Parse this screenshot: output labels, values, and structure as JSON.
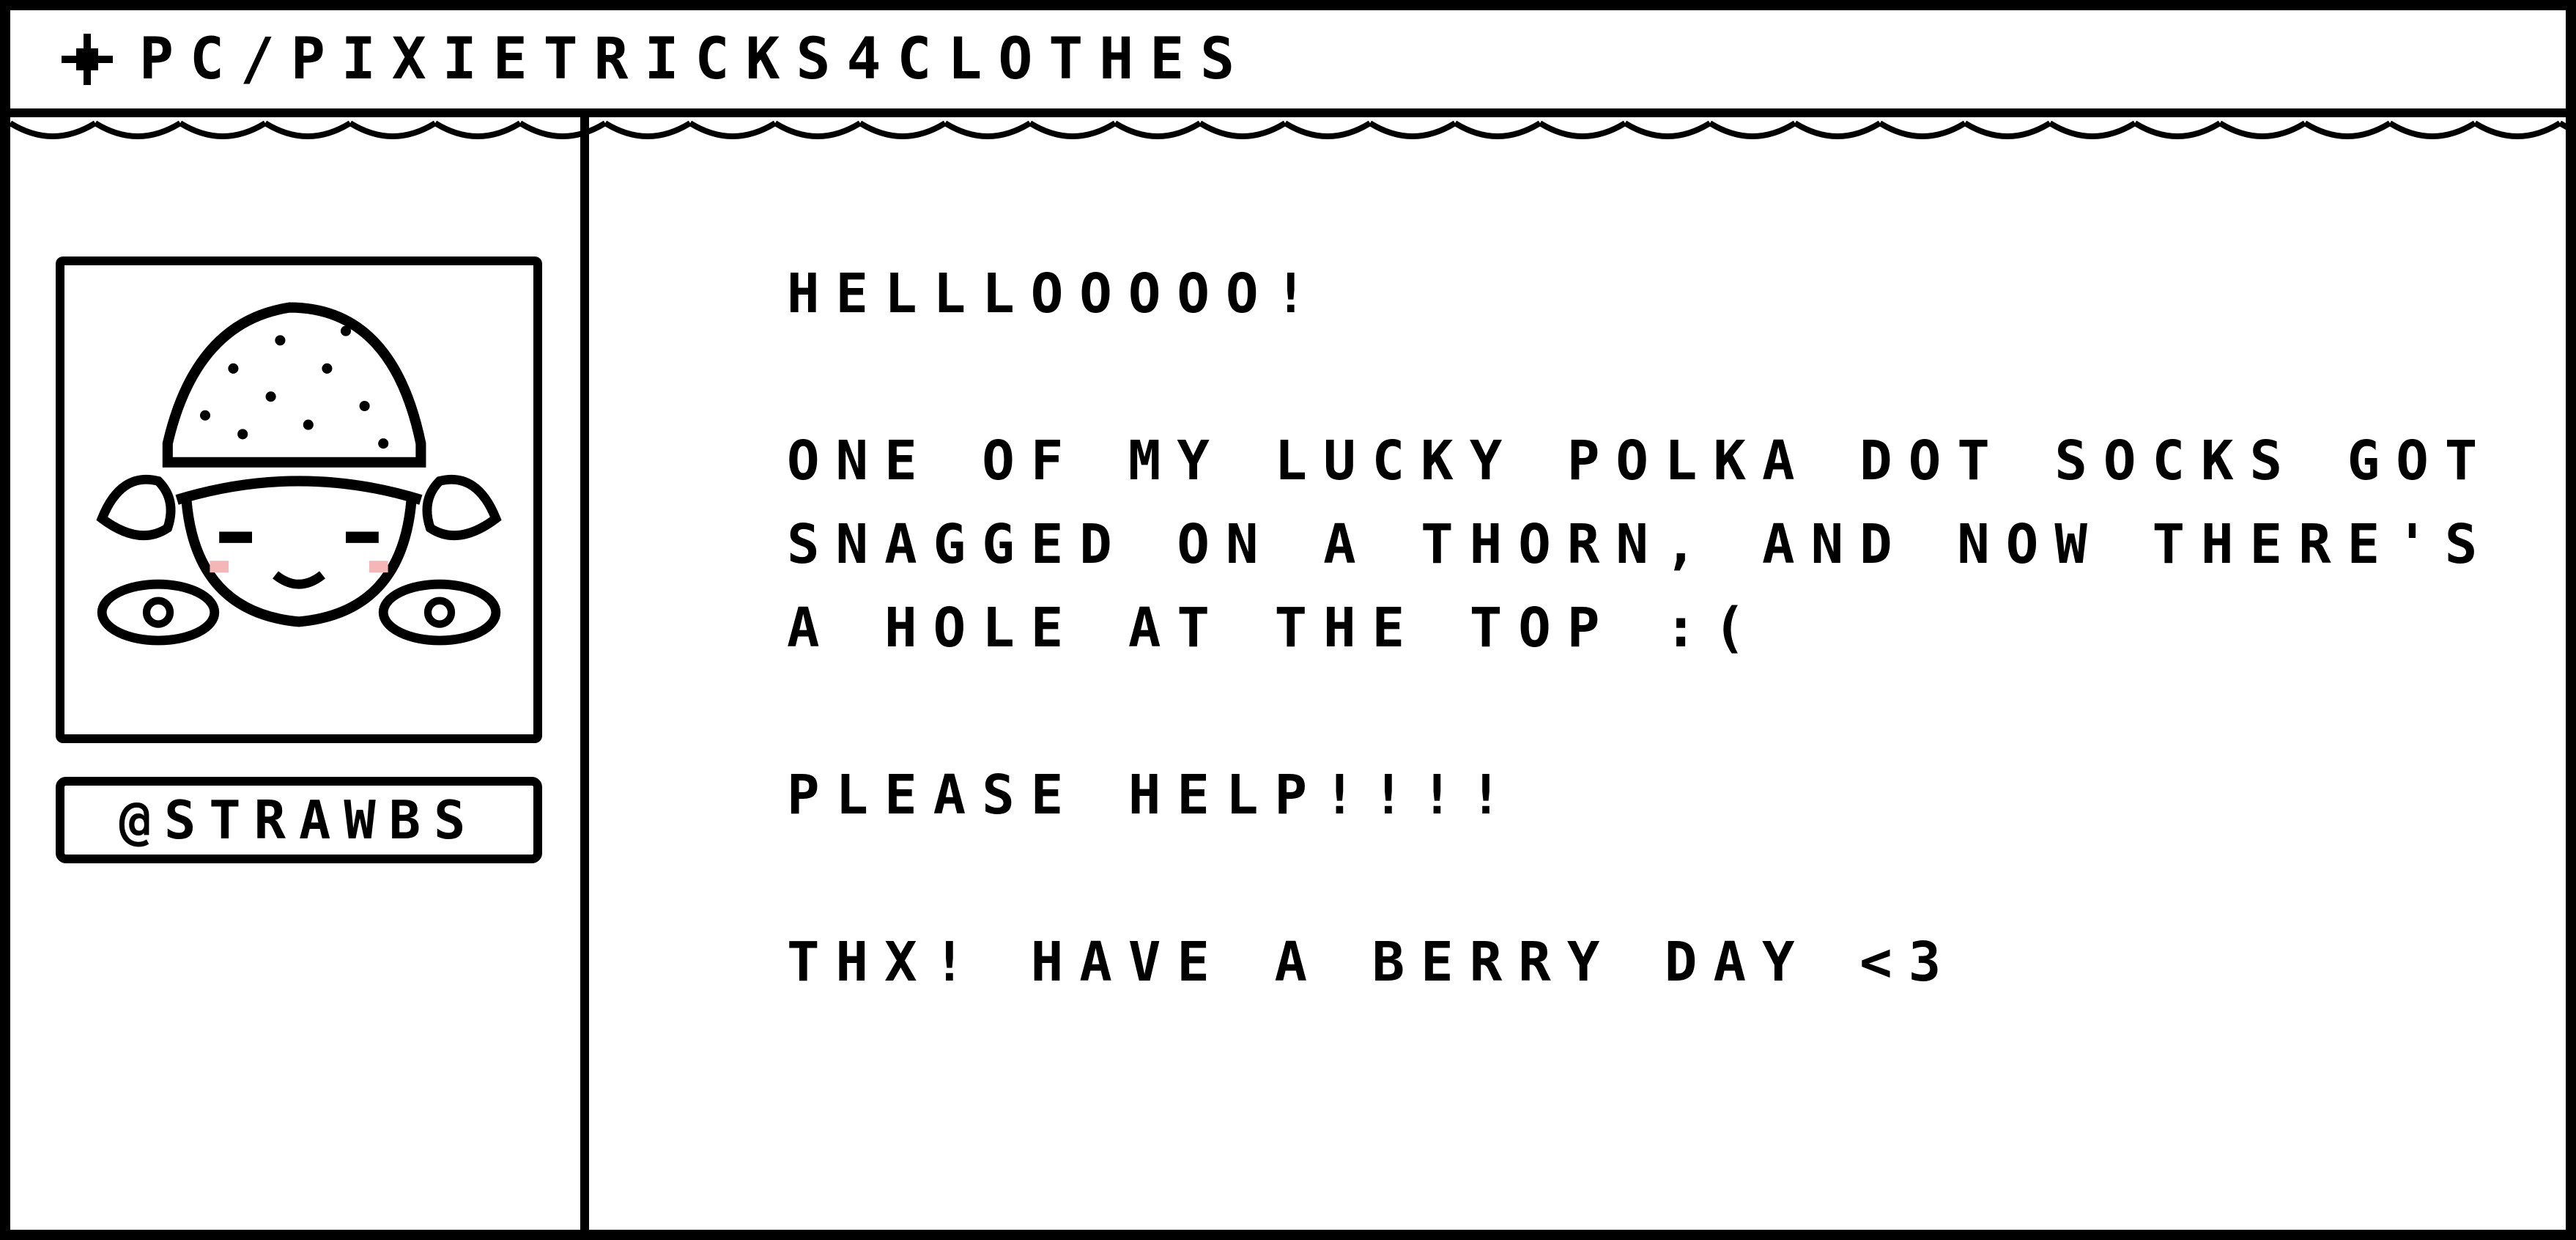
{
  "window": {
    "title": "PC/PIXIETRICKS4CLOTHES",
    "title_icon": "sparkle-icon"
  },
  "sidebar": {
    "avatar": "strawberry-girl-avatar",
    "handle": "@STRAWBS"
  },
  "message": {
    "greeting": "HELLLOOOOO!",
    "body_lines": [
      "ONE OF MY LUCKY POLKA DOT SOCKS GOT",
      "SNAGGED ON A THORN, AND NOW THERE'S",
      "A HOLE AT THE TOP :("
    ],
    "plea": "PLEASE HELP!!!!",
    "signoff": "THX! HAVE A BERRY DAY <3"
  },
  "colors": {
    "ink": "#000000",
    "paper": "#ffffff",
    "blush": "#f4b6b6"
  }
}
